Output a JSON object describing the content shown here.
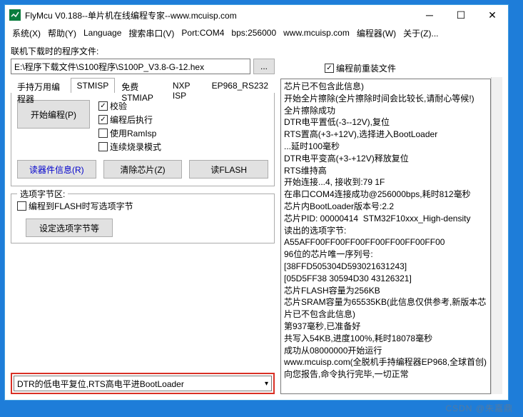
{
  "window": {
    "title": "FlyMcu V0.188--单片机在线编程专家--www.mcuisp.com"
  },
  "menu": {
    "system": "系统(X)",
    "help": "帮助(Y)",
    "language": "Language",
    "searchPort": "搜索串口(V)",
    "port": "Port:COM4",
    "bps": "bps:256000",
    "site": "www.mcuisp.com",
    "programmer": "编程器(W)",
    "about": "关于(Z)..."
  },
  "labels": {
    "pathLabel": "联机下载时的程序文件:",
    "browse": "...",
    "reload": "编程前重装文件",
    "optSection": "选项字节区:",
    "optFlash": "编程到FLASH时写选项字节",
    "setOpt": "设定选项字节等"
  },
  "path": {
    "value": "E:\\程序下载文件\\S100程序\\S100P_V3.8-G-12.hex"
  },
  "tabs": {
    "t1": "手持万用编程器",
    "t2": "STMISP",
    "t3": "免费STMIAP",
    "t4": "NXP ISP",
    "t5": "EP968_RS232"
  },
  "buttons": {
    "startProg": "开始编程(P)",
    "readInfo": "读器件信息(R)",
    "eraseChip": "清除芯片(Z)",
    "readFlash": "读FLASH"
  },
  "opts": {
    "verify": "校验",
    "runAfter": "编程后执行",
    "useRam": "使用RamIsp",
    "contMode": "连续烧录模式"
  },
  "optsChecked": {
    "verify": "✓",
    "runAfter": "✓",
    "useRam": "",
    "contMode": ""
  },
  "reloadChecked": "✓",
  "dropdown": {
    "value": "DTR的低电平复位,RTS高电平进BootLoader"
  },
  "log": "芯片已不包含此信息)\n开始全片擦除(全片擦除时间会比较长,请耐心等候!)\n全片擦除成功\nDTR电平置低(-3--12V),复位\nRTS置高(+3-+12V),选择进入BootLoader\n...延时100毫秒\nDTR电平变高(+3-+12V)释放复位\nRTS维持高\n开始连接...4, 接收到:79 1F\n在串口COM4连接成功@256000bps,耗时812毫秒\n芯片内BootLoader版本号:2.2\n芯片PID: 00000414  STM32F10xxx_High-density\n读出的选项字节:\nA55AFF00FF00FF00FF00FF00FF00FF00\n96位的芯片唯一序列号:\n[38FFD505304D593021631243]\n[05D5FF38 30594D30 43126321]\n芯片FLASH容量为256KB\n芯片SRAM容量为65535KB(此信息仅供参考,新版本芯片已不包含此信息)\n第937毫秒,已准备好\n共写入54KB,进度100%,耗时18078毫秒\n成功从08000000开始运行\nwww.mcuisp.com(全脱机手持编程器EP968,全球首创)向您报告,命令执行完毕,一切正常",
  "watermark": "CSDN @朱嘉鼎"
}
